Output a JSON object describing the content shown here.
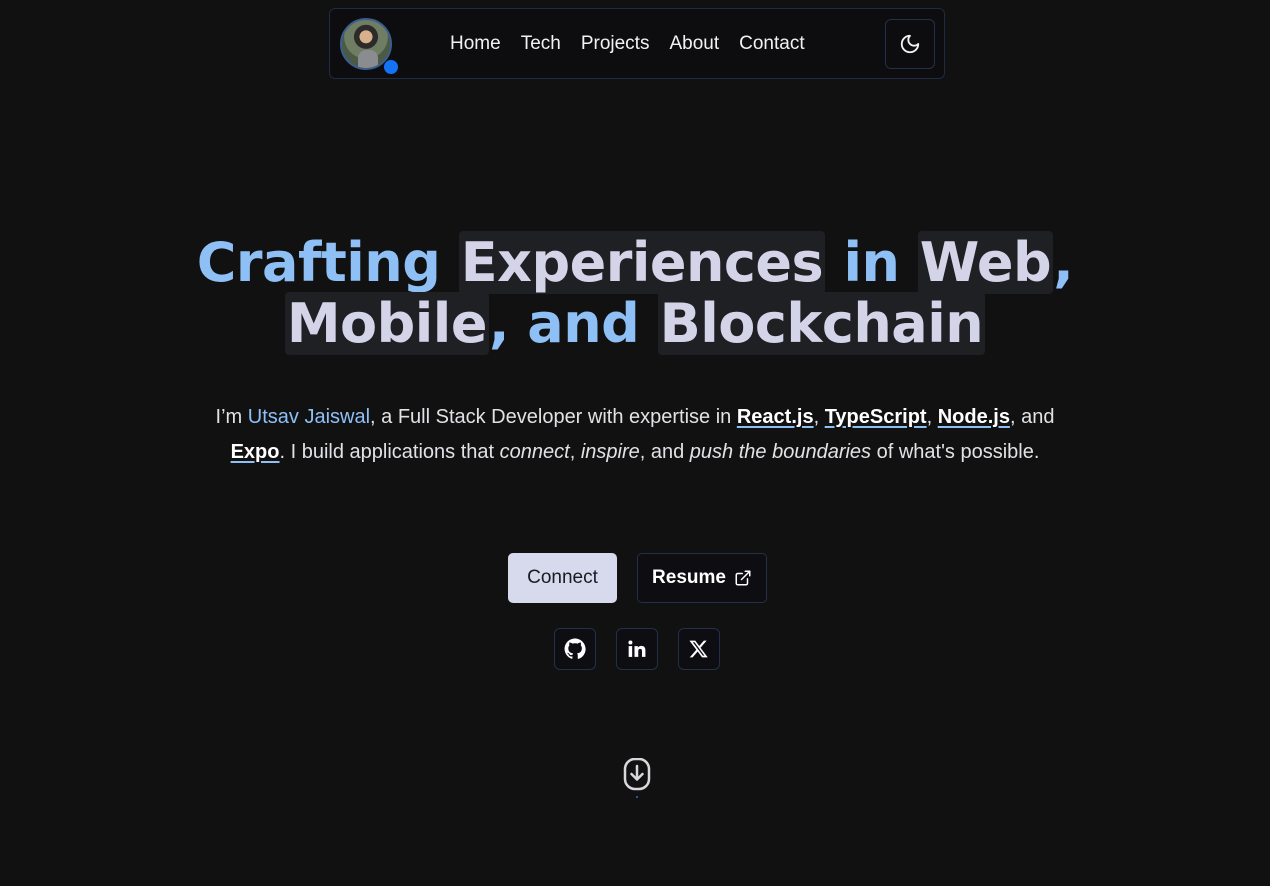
{
  "nav": {
    "avatar_alt": "profile photo",
    "links": [
      "Home",
      "Tech",
      "Projects",
      "About",
      "Contact"
    ],
    "theme_icon": "moon-icon"
  },
  "hero": {
    "headline": {
      "w1": "Crafting",
      "w2": "Experiences",
      "w3": "in",
      "w4": "Web",
      "c1": ",",
      "w5": "Mobile",
      "c2": ",",
      "w6": "and",
      "w7": "Blockchain"
    },
    "intro": {
      "p1": "I’m ",
      "name": "Utsav Jaiswal",
      "p2": ", a Full Stack Developer with expertise in ",
      "t1": "React.js",
      "s1": ", ",
      "t2": "TypeScript",
      "s2": ", ",
      "t3": "Node.js",
      "s3": ", and ",
      "t4": "Expo",
      "p3": ". I build applications that ",
      "e1": "connect",
      "s4": ", ",
      "e2": "inspire",
      "s5": ", and ",
      "e3": "push the boundaries",
      "p4": " of what's possible."
    }
  },
  "buttons": {
    "connect": "Connect",
    "resume": "Resume",
    "resume_icon": "external-link-icon"
  },
  "socials": [
    "github-icon",
    "linkedin-icon",
    "x-icon"
  ],
  "scroll_icon": "scroll-down-mouse-icon",
  "colors": {
    "background": "#111112",
    "accent": "#8ec0f6",
    "chip": "#1f2024",
    "status_dot": "#1473f5"
  }
}
